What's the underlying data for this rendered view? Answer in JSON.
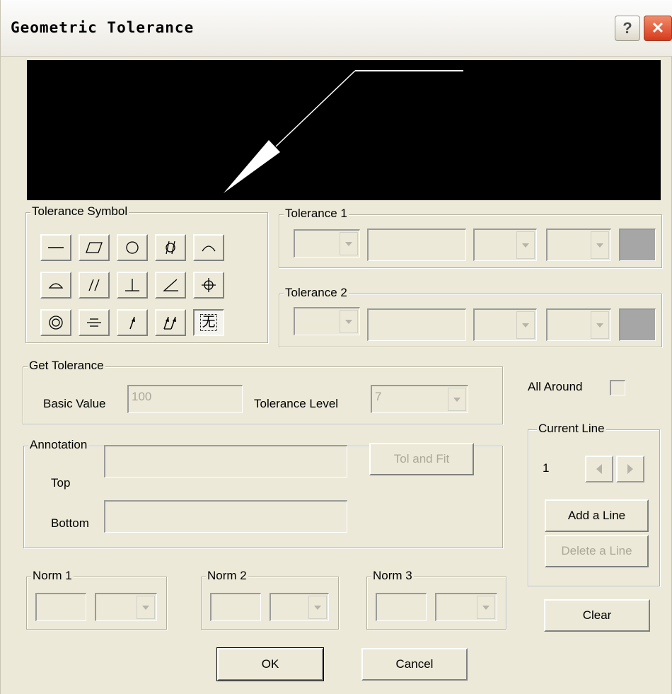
{
  "window": {
    "title": "Geometric Tolerance",
    "help_glyph": "?",
    "close_glyph": "✕"
  },
  "tolerance_symbol": {
    "label": "Tolerance Symbol",
    "symbols": [
      {
        "icon": "straightness-icon"
      },
      {
        "icon": "flatness-icon"
      },
      {
        "icon": "circularity-icon"
      },
      {
        "icon": "cylindricity-icon"
      },
      {
        "icon": "profile-of-line-icon"
      },
      {
        "icon": "profile-of-surface-icon"
      },
      {
        "icon": "parallelism-icon"
      },
      {
        "icon": "perpendicularity-icon"
      },
      {
        "icon": "angularity-icon"
      },
      {
        "icon": "position-icon"
      },
      {
        "icon": "concentricity-icon"
      },
      {
        "icon": "symmetry-icon"
      },
      {
        "icon": "circular-runout-icon"
      },
      {
        "icon": "total-runout-icon"
      },
      {
        "icon": "none-icon",
        "glyph": "无",
        "selected": true
      }
    ]
  },
  "tolerance1": {
    "label": "Tolerance 1"
  },
  "tolerance2": {
    "label": "Tolerance 2"
  },
  "get_tolerance": {
    "label": "Get Tolerance",
    "basic_value_label": "Basic Value",
    "basic_value": "100",
    "tolerance_level_label": "Tolerance Level",
    "tolerance_level": "7"
  },
  "all_around": {
    "label": "All Around",
    "checked": false
  },
  "current_line": {
    "label": "Current Line",
    "value": "1",
    "add_label": "Add a Line",
    "delete_label": "Delete a Line"
  },
  "annotation": {
    "label": "Annotation",
    "top_label": "Top",
    "bottom_label": "Bottom",
    "top_value": "",
    "bottom_value": "",
    "tol_fit_label": "Tol and Fit"
  },
  "norms": [
    {
      "label": "Norm 1"
    },
    {
      "label": "Norm 2"
    },
    {
      "label": "Norm 3"
    }
  ],
  "buttons": {
    "clear": "Clear",
    "ok": "OK",
    "cancel": "Cancel"
  }
}
